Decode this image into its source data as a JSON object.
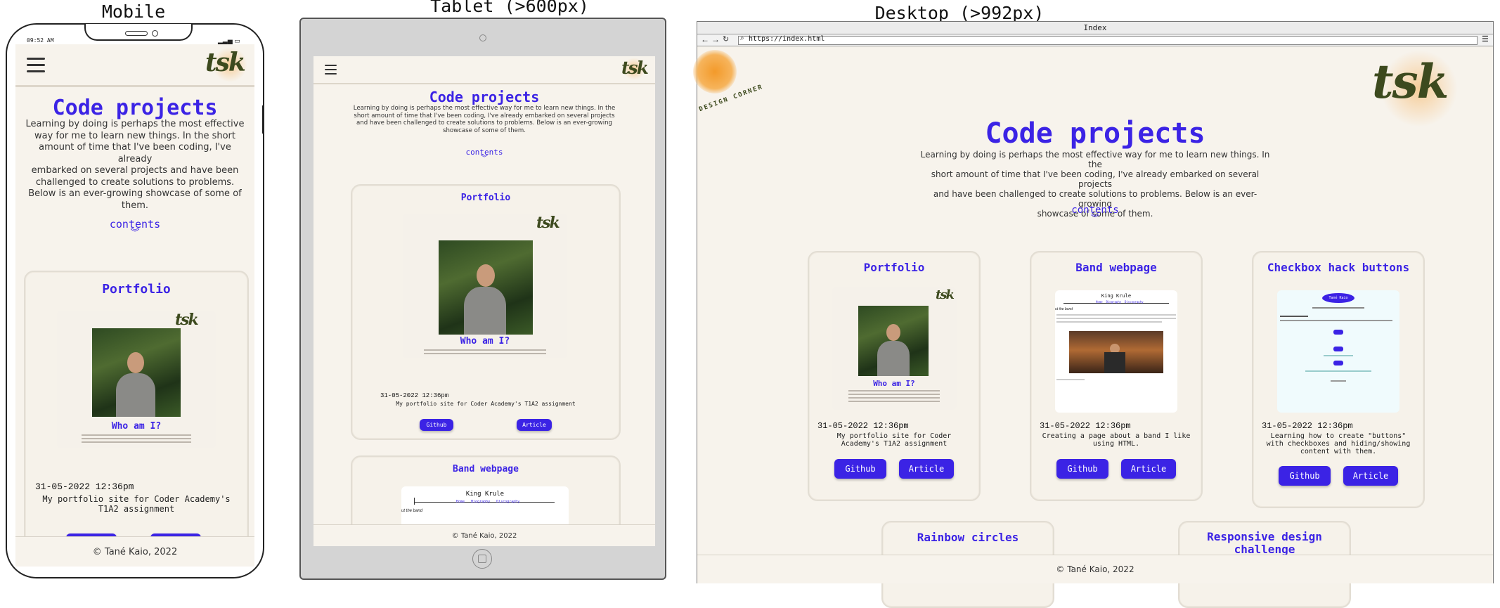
{
  "labels": {
    "mobile": "Mobile",
    "tablet": "Tablet (>600px)",
    "desktop": "Desktop (>992px)"
  },
  "page": {
    "title": "Code projects",
    "intro": "Learning by doing is perhaps the most effective way for me to learn new things. In the short amount of time that I've been coding, I've already embarked on several projects and have been challenged to create solutions to problems. Below is an ever-growing showcase of some of them.",
    "contents": "contents",
    "footer": "© Tané Kaio, 2022",
    "logo": "tsk"
  },
  "mobile": {
    "status_time": "09:52 AM",
    "intro_lines": [
      "Learning by doing is perhaps the most effective",
      "way for me to learn new things. In the short",
      "amount of time that I've been coding, I've already",
      "embarked on several projects and have been",
      "challenged to create solutions to problems.",
      "Below is an ever-growing showcase of some of",
      "them."
    ]
  },
  "tablet": {
    "intro_lines": [
      "Learning by doing is perhaps the most effective way for me to learn new things. In the",
      "short amount of time that I've been coding, I've already embarked on several projects",
      "and have been challenged to create solutions to problems. Below is an ever-growing",
      "showcase of some of them."
    ]
  },
  "desktop": {
    "window_title": "Index",
    "url": "https://index.html",
    "badge_text": "DESIGN CORNER",
    "intro_lines": [
      "Learning by doing is perhaps the most effective way for me to learn new things. In the",
      "short amount of time that I've been coding, I've already embarked on several projects",
      "and have been challenged to create solutions to problems. Below is an ever-growing",
      "showcase of some of them."
    ]
  },
  "projects": [
    {
      "title": "Portfolio",
      "date": "31-05-2022 12:36pm",
      "desc": "My portfolio site for Coder Academy's T1A2 assignment",
      "github": "Github",
      "article": "Article",
      "preview_heading": "Who am I?"
    },
    {
      "title": "Band webpage",
      "date": "31-05-2022 12:36pm",
      "desc": "Creating a page about a band I like using HTML.",
      "github": "Github",
      "article": "Article",
      "preview_heading": "King Krule",
      "preview_nav": [
        "Home",
        "Biography",
        "Discography"
      ],
      "preview_text": "ut the band"
    },
    {
      "title": "Checkbox hack buttons",
      "date": "31-05-2022 12:36pm",
      "desc": "Learning how to create \"buttons\" with checkboxes and hiding/showing content with them.",
      "github": "Github",
      "article": "Article",
      "preview_heading": "Tané Kaio"
    },
    {
      "title": "Rainbow circles"
    },
    {
      "title": "Responsive design challenge"
    }
  ],
  "colors": {
    "accent": "#3b23e5",
    "page_bg": "#f7f3ec",
    "logo": "#3d4a1e",
    "sun": "#f3a43a"
  }
}
